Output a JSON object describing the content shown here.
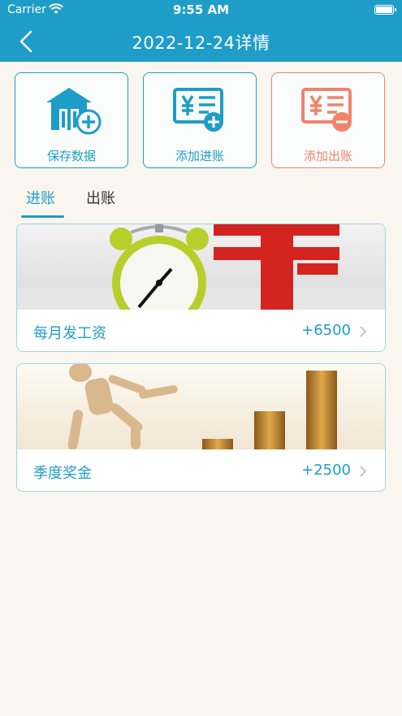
{
  "status_bar": {
    "carrier": "Carrier",
    "time": "9:55 AM"
  },
  "nav": {
    "title": "2022-12-24详情",
    "back_icon": "chevron-left-icon"
  },
  "actions": [
    {
      "label": "保存数据",
      "icon": "save-house-plus-icon",
      "color": "#1e9dc8"
    },
    {
      "label": "添加进账",
      "icon": "bill-plus-icon",
      "color": "#1e9dc8"
    },
    {
      "label": "添加出账",
      "icon": "bill-minus-icon",
      "color": "#f0836a"
    }
  ],
  "tabs": {
    "income": "进账",
    "expense": "出账",
    "active": "income"
  },
  "entries": [
    {
      "name": "每月发工资",
      "amount": "+6500",
      "photo": "alarm-clock-and-yuan-photo"
    },
    {
      "name": "季度奖金",
      "amount": "+2500",
      "photo": "wooden-figure-climbing-coins-photo"
    }
  ],
  "colors": {
    "accent": "#1e9dc8",
    "expense": "#f0836a",
    "background": "#f8f6ee"
  }
}
